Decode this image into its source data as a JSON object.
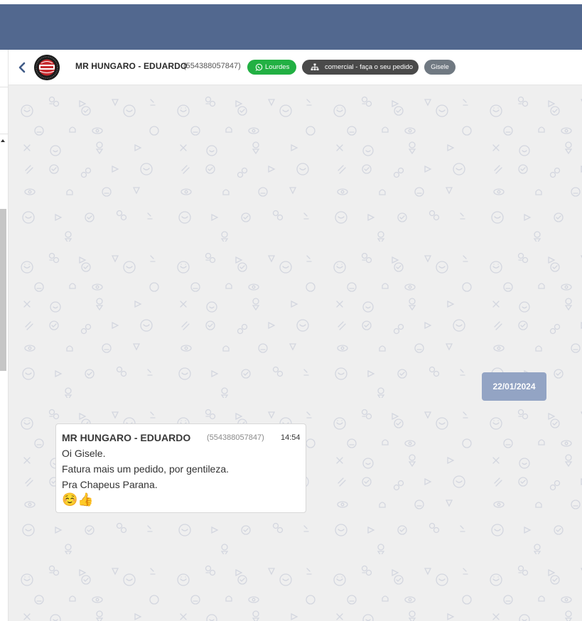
{
  "header": {
    "contact_name": "MR HUNGARO - EDUARDO",
    "contact_phone": "(554388057847)",
    "tags": {
      "agent": "Lourdes",
      "queue": "comercial - faça o seu pedido",
      "user": "Gisele"
    },
    "colors": {
      "app_bar": "#52688f",
      "agent_tag": "#22b043",
      "queue_tag": "#4a4a4a",
      "user_tag": "#707982"
    },
    "icons": {
      "back": "chevron-left-icon",
      "agent_tag": "whatsapp-icon",
      "queue_tag": "sitemap-icon"
    }
  },
  "chat": {
    "date_separator": "22/01/2024",
    "messages": [
      {
        "sender": "MR HUNGARO - EDUARDO",
        "sender_phone": "(554388057847)",
        "time": "14:54",
        "lines": [
          "Oi Gisele.",
          "Fatura mais um pedido, por gentileza.",
          "Pra Chapeus Parana."
        ],
        "emoji": "☺️👍"
      }
    ],
    "colors": {
      "background": "#efefef",
      "date_chip": "#93a4c4"
    }
  }
}
